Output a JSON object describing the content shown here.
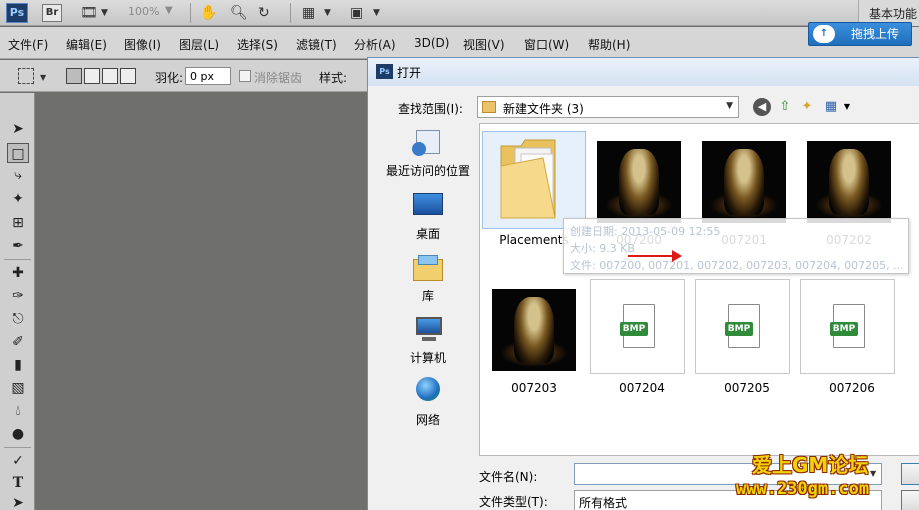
{
  "appbar": {
    "ps_logo": "Ps",
    "br_logo": "Br",
    "zoom": "100%",
    "workspace": "基本功能"
  },
  "menu": {
    "items": [
      "文件(F)",
      "编辑(E)",
      "图像(I)",
      "图层(L)",
      "选择(S)",
      "滤镜(T)",
      "分析(A)",
      "3D(D)",
      "视图(V)",
      "窗口(W)",
      "帮助(H)"
    ]
  },
  "upload": {
    "label": "拖拽上传",
    "icon": "cloud-upload-icon"
  },
  "options": {
    "feather_label": "羽化:",
    "feather_value": "0 px",
    "antialias_label": "消除锯齿",
    "style_label": "样式:"
  },
  "dialog": {
    "title": "打开",
    "lookin_label": "查找范围(I):",
    "lookin_value": "新建文件夹 (3)",
    "places": [
      {
        "label": "最近访问的位置",
        "icon": "recent-places-icon"
      },
      {
        "label": "桌面",
        "icon": "desktop-icon"
      },
      {
        "label": "库",
        "icon": "library-icon"
      },
      {
        "label": "计算机",
        "icon": "computer-icon"
      },
      {
        "label": "网络",
        "icon": "network-icon"
      }
    ],
    "files": [
      {
        "name": "Placements",
        "kind": "folder"
      },
      {
        "name": "007200",
        "kind": "image"
      },
      {
        "name": "007201",
        "kind": "image"
      },
      {
        "name": "007202",
        "kind": "image"
      },
      {
        "name": "007203",
        "kind": "image"
      },
      {
        "name": "007204",
        "kind": "bmp"
      },
      {
        "name": "007205",
        "kind": "bmp"
      },
      {
        "name": "007206",
        "kind": "bmp"
      }
    ],
    "bmp_tag": "BMP",
    "tooltip": {
      "line1": "创建日期: 2013-05-09 12:55",
      "line2": "大小: 9.3 KB",
      "line3": "文件: 007200, 007201, 007202, 007203, 007204, 007205, ..."
    },
    "filename_label": "文件名(N):",
    "filename_value": "",
    "filetype_label": "文件类型(T):",
    "filetype_value": "所有格式"
  },
  "watermark": {
    "line1": "爱上GM论坛",
    "line2": "www.230gm.com"
  },
  "colors": {
    "upload_blue": "#1e6fbd",
    "watermark_yellow": "#f5d10a",
    "tooltip_arrow": "#e01818",
    "bmp_green": "#2f8a3a"
  }
}
